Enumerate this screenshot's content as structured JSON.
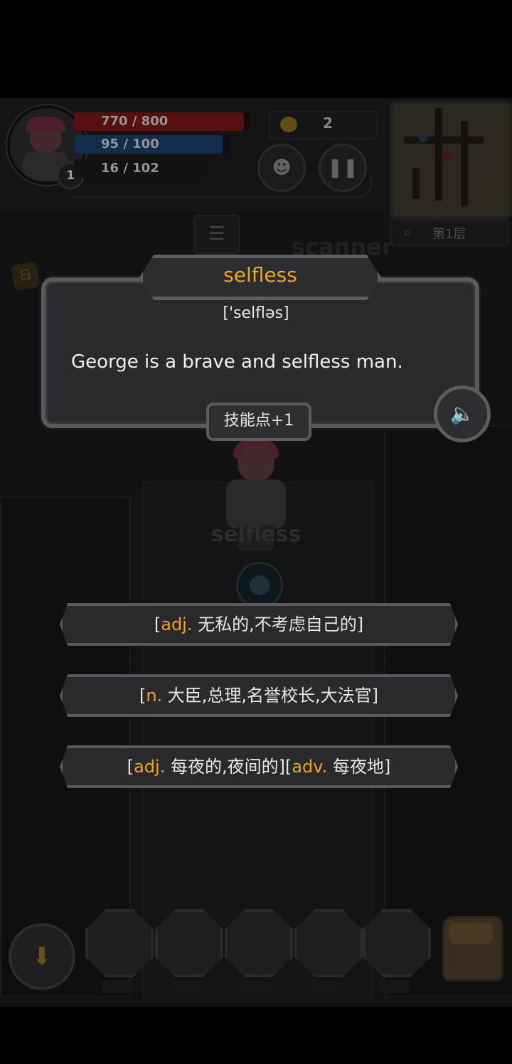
{
  "hud": {
    "hp": "770 / 800",
    "hp_ratio": 0.9625,
    "mp": "95 / 100",
    "mp_ratio": 0.95,
    "xp": "16 / 102",
    "level": "1",
    "gold": "2",
    "pet_icon": "pet-face-icon",
    "pause_icon": "pause-icon",
    "floor": "第1层",
    "menu_icon": "list-icon"
  },
  "background": {
    "scanner_text": "scanner",
    "ghost_word": "selfless"
  },
  "card": {
    "word": "selfless",
    "phonetic": "['selfləs]",
    "sentence": "George is a brave and selfless man.",
    "reward": "技能点+1",
    "speaker_icon": "speaker-icon"
  },
  "answers": [
    {
      "pos1": "adj.",
      "text1": " 无私的,不考虑自己的",
      "pos2": "",
      "text2": ""
    },
    {
      "pos1": "n.",
      "text1": " 大臣,总理,名誉校长,大法官",
      "pos2": "",
      "text2": ""
    },
    {
      "pos1": "adj.",
      "text1": " 每夜的,夜间的",
      "pos2": "adv.",
      "text2": " 每夜地"
    }
  ],
  "colors": {
    "accent": "#f0a32a",
    "hp": "#7a1616",
    "mp": "#1c3e6a"
  }
}
